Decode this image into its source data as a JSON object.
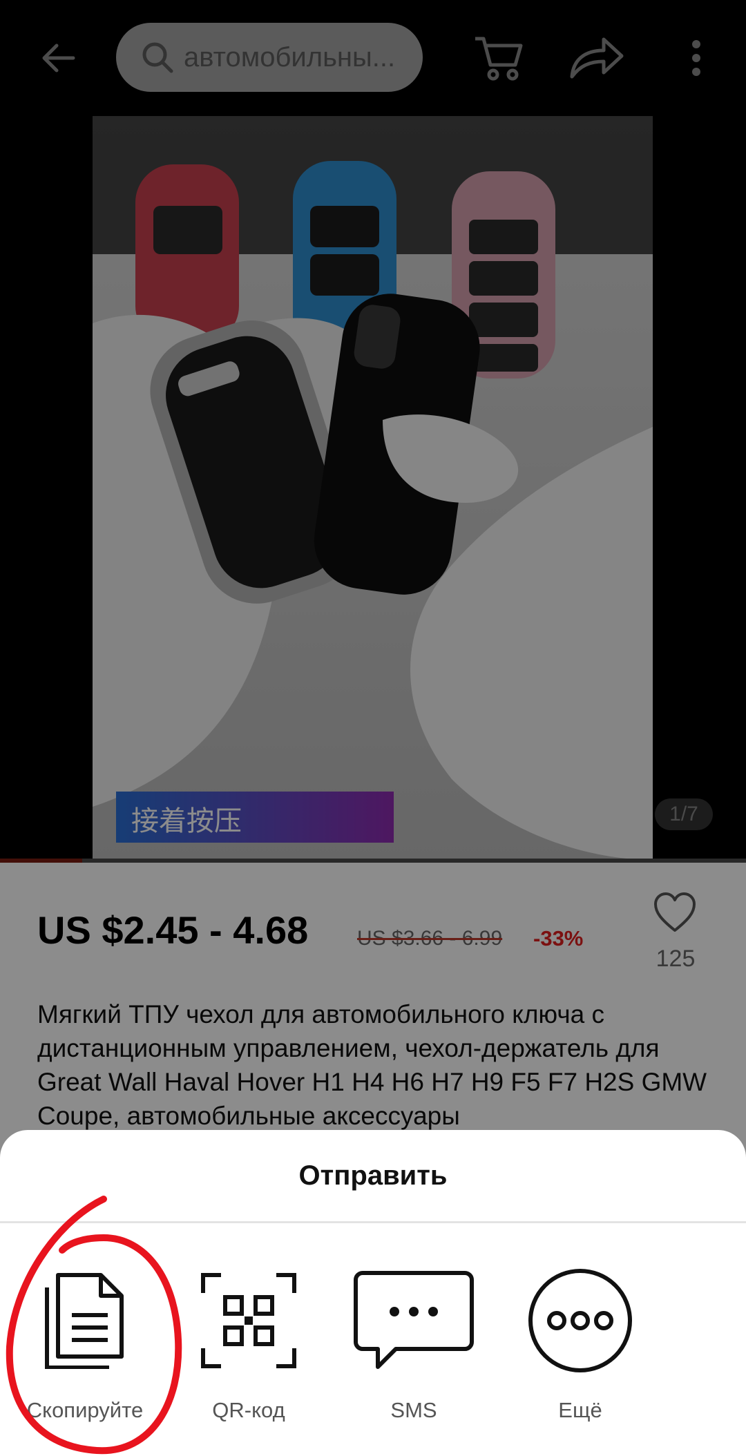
{
  "header": {
    "search_placeholder": "автомобильны...",
    "icons": [
      "back-arrow-icon",
      "search-icon",
      "cart-icon",
      "share-icon",
      "more-vertical-icon"
    ]
  },
  "gallery": {
    "overlay_caption": "接着按压",
    "counter": "1/7",
    "video_progress": 0.11
  },
  "product": {
    "price": "US $2.45 - 4.68",
    "old_price": "US $3.66 - 6.99",
    "discount": "-33%",
    "likes": "125",
    "title": "Мягкий ТПУ чехол для автомобильного ключа с дистанционным управлением, чехол-держатель для Great Wall Haval Hover H1 H4 H6 H7 H9 F5 F7 H2S GMW Coupe, автомобильные аксессуары"
  },
  "share_sheet": {
    "title": "Отправить",
    "options": [
      {
        "label": "Скопируйте",
        "icon": "copy-icon"
      },
      {
        "label": "QR-код",
        "icon": "qr-code-icon"
      },
      {
        "label": "SMS",
        "icon": "sms-icon"
      },
      {
        "label": "Ещё",
        "icon": "more-icon"
      }
    ]
  },
  "colors": {
    "accent_red": "#e02020",
    "annotation_red": "#e8141e",
    "gallery_caption_gradient": [
      "#2a6fd6",
      "#8e2bb0"
    ]
  }
}
